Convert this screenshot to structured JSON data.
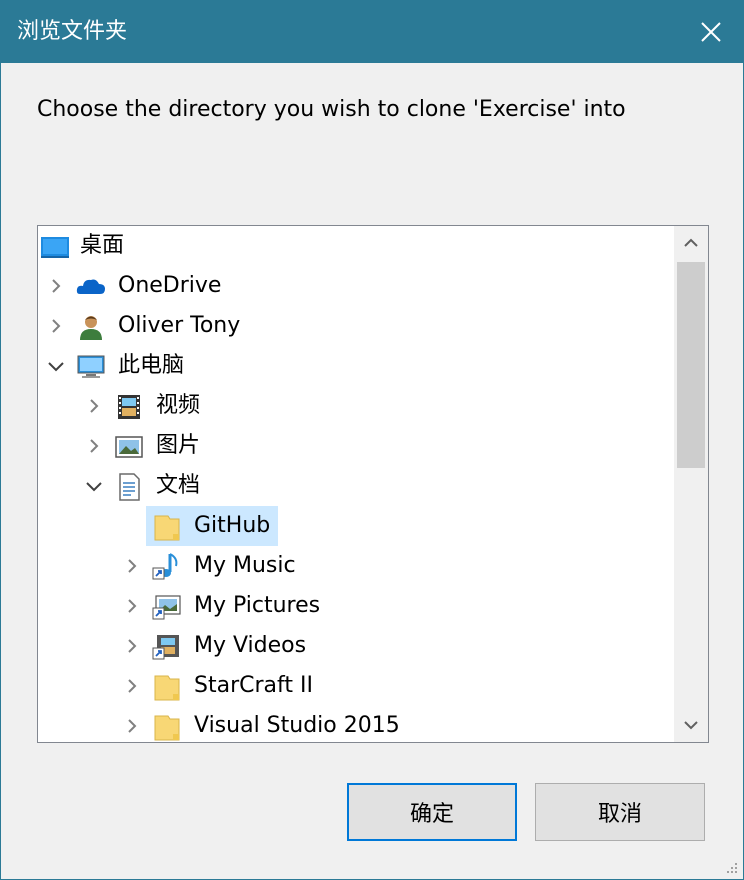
{
  "window": {
    "title": "浏览文件夹",
    "close_glyph": "✕"
  },
  "prompt": "Choose the directory you wish to clone 'Exercise' into",
  "tree": {
    "items": [
      {
        "label": "桌面",
        "icon": "desktop-icon",
        "expander": "none",
        "level": 0
      },
      {
        "label": "OneDrive",
        "icon": "onedrive-cloud-icon",
        "expander": "collapsed",
        "level": 0
      },
      {
        "label": "Oliver Tony",
        "icon": "user-icon",
        "expander": "collapsed",
        "level": 0
      },
      {
        "label": "此电脑",
        "icon": "computer-icon",
        "expander": "expanded",
        "level": 0
      },
      {
        "label": "视频",
        "icon": "video-folder-icon",
        "expander": "collapsed",
        "level": 1
      },
      {
        "label": "图片",
        "icon": "pictures-folder-icon",
        "expander": "collapsed",
        "level": 1
      },
      {
        "label": "文档",
        "icon": "documents-folder-icon",
        "expander": "expanded",
        "level": 1
      },
      {
        "label": "GitHub",
        "icon": "folder-icon",
        "expander": "none",
        "level": 2,
        "selected": true
      },
      {
        "label": "My Music",
        "icon": "music-shortcut-icon",
        "expander": "collapsed",
        "level": 2
      },
      {
        "label": "My Pictures",
        "icon": "pictures-shortcut-icon",
        "expander": "collapsed",
        "level": 2
      },
      {
        "label": "My Videos",
        "icon": "videos-shortcut-icon",
        "expander": "collapsed",
        "level": 2
      },
      {
        "label": "StarCraft II",
        "icon": "folder-icon",
        "expander": "collapsed",
        "level": 2
      },
      {
        "label": "Visual Studio 2015",
        "icon": "folder-icon",
        "expander": "collapsed",
        "level": 2
      }
    ]
  },
  "buttons": {
    "ok_label": "确定",
    "cancel_label": "取消"
  },
  "colors": {
    "titlebar": "#2b7a96",
    "selection": "#cce8ff",
    "primary_border": "#0078d7",
    "folder": "#f8d775"
  }
}
